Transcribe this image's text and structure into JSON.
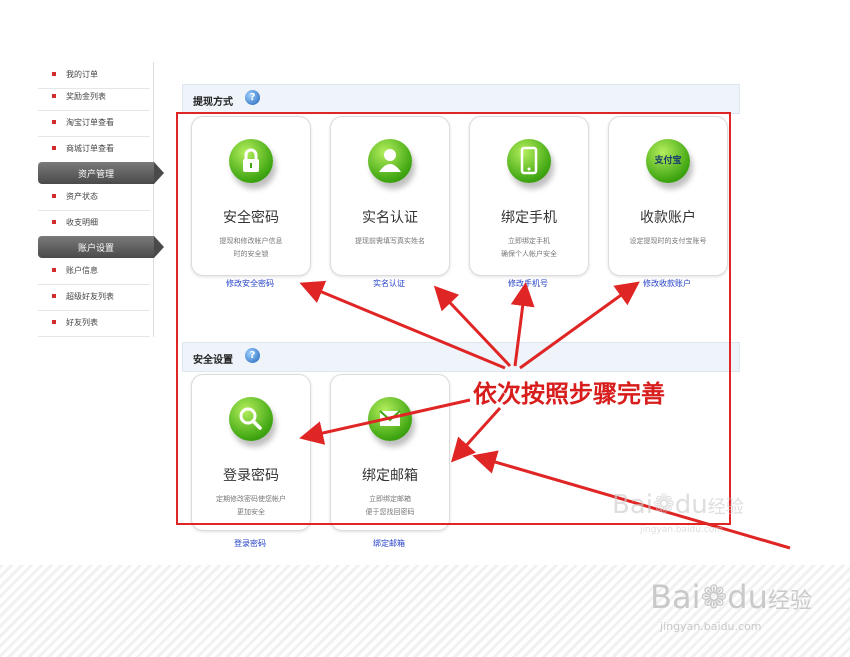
{
  "sidebar": {
    "items_top": [
      "我的订单",
      "奖励金列表",
      "淘宝订单查看",
      "商城订单查看"
    ],
    "group1": "资产管理",
    "items_mid": [
      "资产状态",
      "收支明细"
    ],
    "group2": "账户设置",
    "items_bottom": [
      "账户信息",
      "超级好友列表",
      "好友列表"
    ]
  },
  "withdraw": {
    "title": "提现方式",
    "cards": [
      {
        "icon": "lock-icon",
        "name": "安全密码",
        "desc1": "提现和修改帐户信息",
        "desc2": "时的安全锁",
        "link": "修改安全密码"
      },
      {
        "icon": "person-icon",
        "name": "实名认证",
        "desc1": "提现前需填写真实姓名",
        "desc2": "",
        "link": "实名认证"
      },
      {
        "icon": "phone-icon",
        "name": "绑定手机",
        "desc1": "立即绑定手机",
        "desc2": "确保个人帐户安全",
        "link": "修改手机号"
      },
      {
        "icon": "alipay-icon",
        "name": "收款账户",
        "desc1": "设定提现时的支付宝账号",
        "desc2": "",
        "link": "修改收款账户",
        "badge_text": "支付宝"
      }
    ]
  },
  "security": {
    "title": "安全设置",
    "cards": [
      {
        "icon": "search-key-icon",
        "name": "登录密码",
        "desc1": "定期修改密码使您帐户",
        "desc2": "更加安全",
        "link": "登录密码"
      },
      {
        "icon": "mail-icon",
        "name": "绑定邮箱",
        "desc1": "立即绑定邮箱",
        "desc2": "便于您找回密码",
        "link": "绑定邮箱"
      }
    ]
  },
  "callout": "依次按照步骤完善",
  "watermark": {
    "brand": "Bai",
    "paw": "du",
    "cn": "经验",
    "url": "jingyan.baidu.com"
  },
  "colors": {
    "accent_red": "#e02525",
    "link_blue": "#2440c8",
    "badge_green": "#3ea511"
  }
}
